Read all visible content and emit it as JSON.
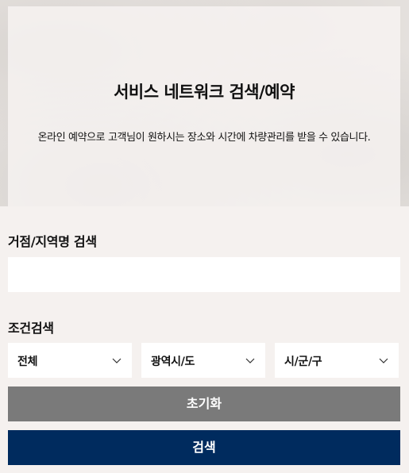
{
  "hero": {
    "title": "서비스 네트워크 검색/예약",
    "description": "온라인 예약으로 고객님이 원하시는 장소와 시간에 차량관리를 받을 수 있습니다."
  },
  "location_search": {
    "label": "거점/지역명 검색",
    "value": "",
    "placeholder": ""
  },
  "condition_search": {
    "label": "조건검색",
    "selects": [
      {
        "value": "전체",
        "icon": "chevron-down-icon"
      },
      {
        "value": "광역시/도",
        "icon": "chevron-down-icon"
      },
      {
        "value": "시/군/구",
        "icon": "chevron-down-icon"
      }
    ]
  },
  "buttons": {
    "reset_label": "초기화",
    "search_label": "검색"
  },
  "colors": {
    "page_background": "#f5f1ef",
    "reset_button": "#7a7a7a",
    "search_button": "#002b5e"
  }
}
